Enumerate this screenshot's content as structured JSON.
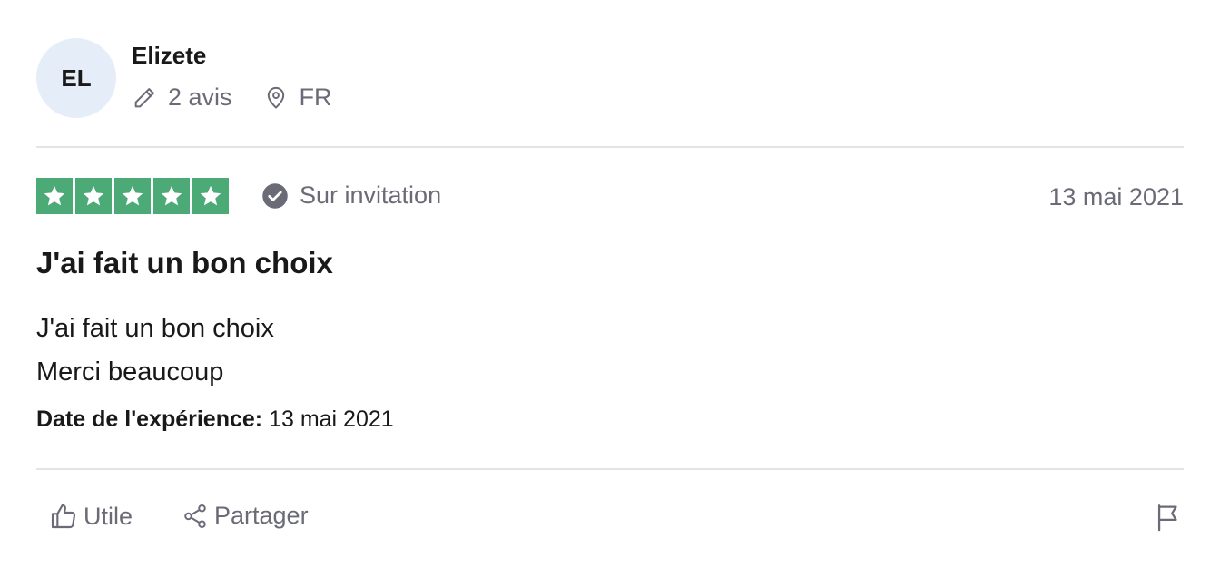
{
  "reviewer": {
    "initials": "EL",
    "name": "Elizete",
    "reviews_count": "2 avis",
    "country": "FR"
  },
  "review": {
    "rating": 5,
    "rating_max": 5,
    "verification_label": "Sur invitation",
    "date": "13 mai 2021",
    "title": "J'ai fait un bon choix",
    "body_lines": [
      "J'ai fait un bon choix",
      "Merci beaucoup"
    ],
    "experience_label": "Date de l'expérience:",
    "experience_date": "13 mai 2021"
  },
  "actions": {
    "useful_label": "Utile",
    "share_label": "Partager"
  },
  "colors": {
    "star_green": "#4caa76",
    "muted_text": "#6b6b78",
    "avatar_bg": "#e5eef8"
  },
  "icons": {
    "reviews": "pencil-icon",
    "country": "location-pin-icon",
    "verified": "check-circle-icon",
    "useful": "thumbs-up-icon",
    "share": "share-icon",
    "report": "flag-icon"
  }
}
